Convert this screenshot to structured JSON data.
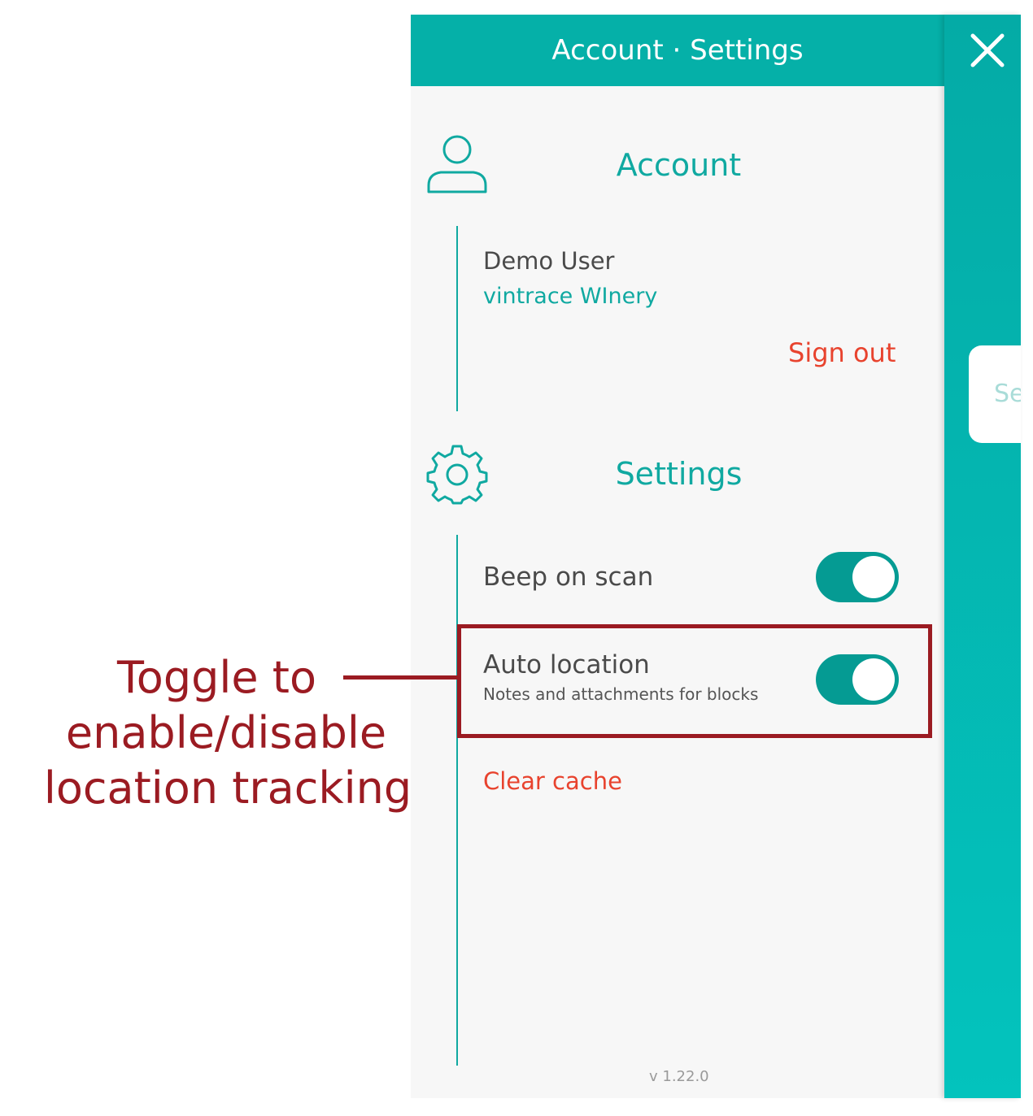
{
  "header": {
    "title": "Account · Settings"
  },
  "side_tab": {
    "label": "Se"
  },
  "account": {
    "title": "Account",
    "user_name": "Demo User",
    "company": "vintrace WInery",
    "sign_out_label": "Sign out"
  },
  "settings": {
    "title": "Settings",
    "beep_on_scan": {
      "label": "Beep on scan",
      "enabled": true
    },
    "auto_location": {
      "label": "Auto location",
      "sublabel": "Notes and attachments for blocks",
      "enabled": true
    },
    "clear_cache_label": "Clear cache"
  },
  "version": "v 1.22.0",
  "annotation": {
    "lines": [
      "Toggle to",
      "enable/disable",
      "location tracking"
    ]
  },
  "colors": {
    "accent": "#10a9a1",
    "header_bg": "#05b0a8",
    "danger": "#e8432e",
    "annotation": "#9b1b22"
  },
  "icons": [
    "close-icon",
    "user-icon",
    "gear-icon"
  ]
}
